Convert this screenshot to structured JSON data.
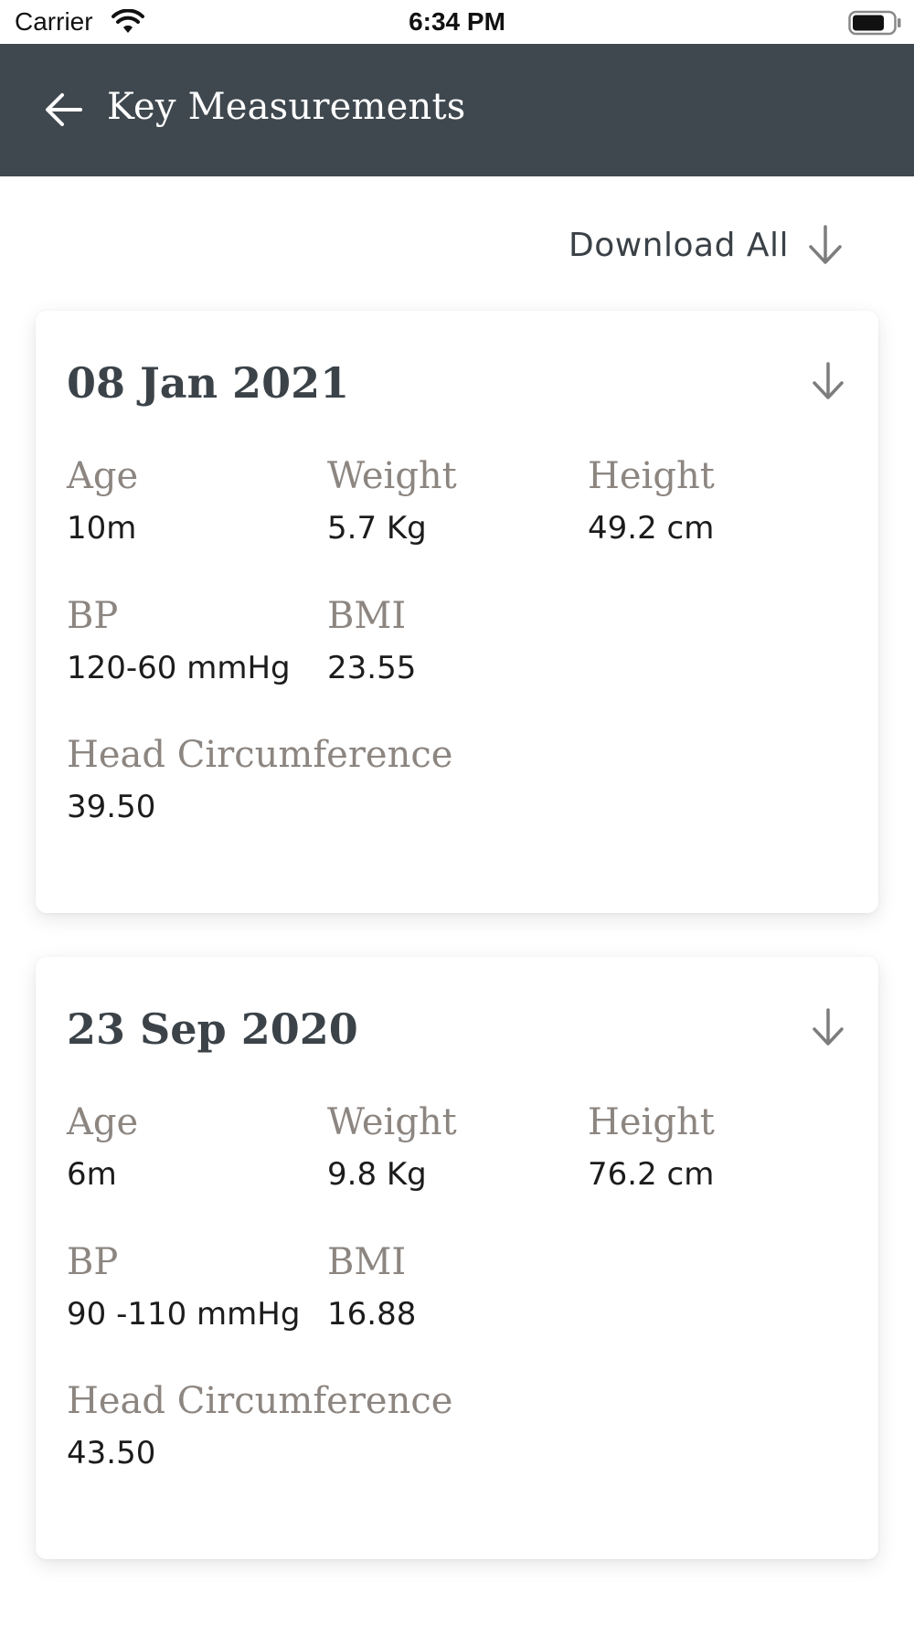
{
  "status_bar": {
    "carrier": "Carrier",
    "time": "6:34 PM"
  },
  "header": {
    "title": "Key Measurements"
  },
  "download_all": {
    "label": "Download All"
  },
  "records": [
    {
      "date": "08 Jan 2021",
      "age_label": "Age",
      "age": "10m",
      "weight_label": "Weight",
      "weight": "5.7 Kg",
      "height_label": "Height",
      "height": "49.2 cm",
      "bp_label": "BP",
      "bp": "120-60 mmHg",
      "bmi_label": "BMI",
      "bmi": "23.55",
      "head_label": "Head Circumference",
      "head": "39.50"
    },
    {
      "date": "23 Sep 2020",
      "age_label": "Age",
      "age": "6m",
      "weight_label": "Weight",
      "weight": "9.8 Kg",
      "height_label": "Height",
      "height": "76.2 cm",
      "bp_label": "BP",
      "bp": "90 -110 mmHg",
      "bmi_label": "BMI",
      "bmi": "16.88",
      "head_label": "Head Circumference",
      "head": "43.50"
    }
  ],
  "icons": {
    "back": "arrow-left-icon",
    "download": "arrow-down-icon",
    "wifi": "wifi-icon",
    "battery": "battery-icon"
  },
  "colors": {
    "header_bg": "#3f484f",
    "label": "#8c8580",
    "value": "#1c1c1c",
    "date": "#3b4349"
  }
}
